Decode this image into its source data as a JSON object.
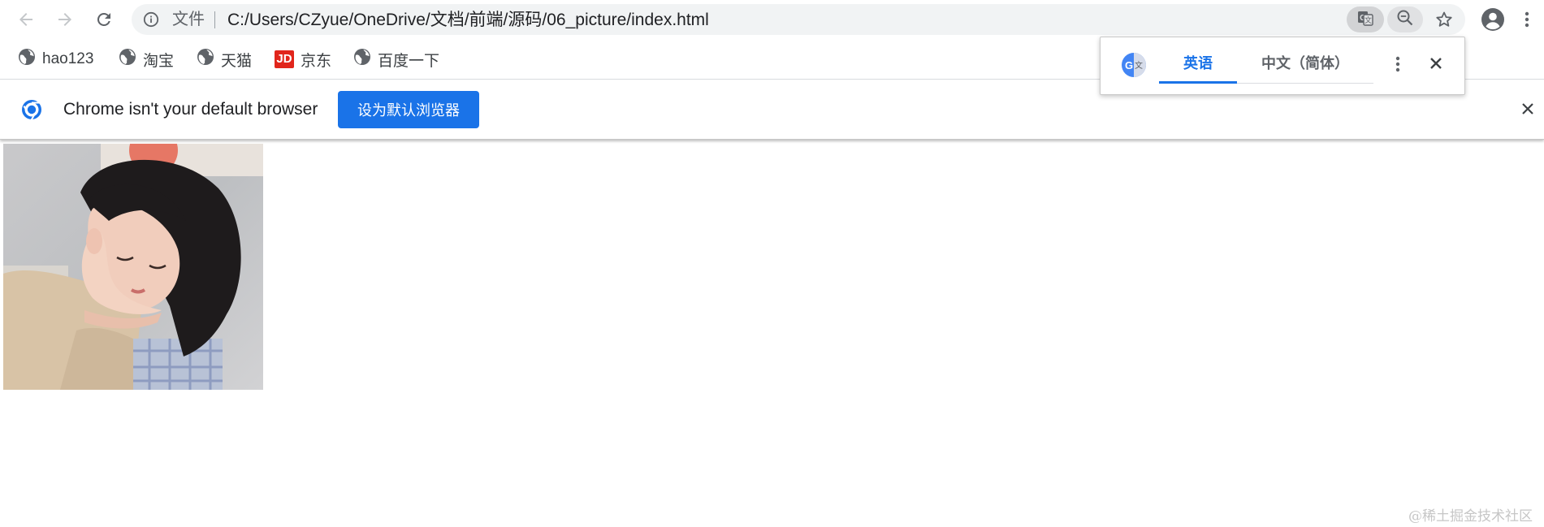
{
  "toolbar": {
    "back_icon": "arrow-left-icon",
    "forward_icon": "arrow-right-icon",
    "reload_icon": "reload-icon",
    "profile_icon": "account-circle-icon",
    "menu_icon": "vertical-dots-icon"
  },
  "omnibox": {
    "scheme_label": "文件",
    "url": "C:/Users/CZyue/OneDrive/文档/前端/源码/06_picture/index.html",
    "info_icon": "info-icon",
    "translate_icon": "translate-icon",
    "zoom_icon": "zoom-out-icon",
    "bookmark_icon": "star-outline-icon"
  },
  "bookmarks": [
    {
      "label": "hao123",
      "icon": "globe-icon"
    },
    {
      "label": "淘宝",
      "icon": "globe-icon"
    },
    {
      "label": "天猫",
      "icon": "globe-icon"
    },
    {
      "label": "京东",
      "icon": "jd-logo",
      "logo_text": "JD"
    },
    {
      "label": "百度一下",
      "icon": "globe-icon"
    }
  ],
  "infobar": {
    "message": "Chrome isn't your default browser",
    "button_label": "设为默认浏览器",
    "icon": "chrome-logo-icon",
    "close_icon": "close-icon"
  },
  "page": {
    "image_alt": "photo of a girl resting her face on her hands"
  },
  "translate": {
    "source_language": "英语",
    "target_language": "中文（简体）",
    "logo_icon": "google-translate-icon",
    "more_icon": "vertical-dots-icon",
    "close_icon": "close-icon"
  },
  "watermark": "@稀土掘金技术社区",
  "colors": {
    "accent": "#1a73e8",
    "omnibox_bg": "#f1f3f4",
    "jd_red": "#e1251b"
  }
}
